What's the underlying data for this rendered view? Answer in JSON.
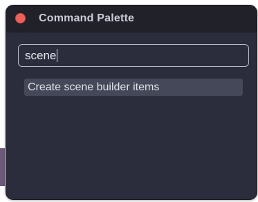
{
  "window": {
    "title": "Command Palette"
  },
  "search": {
    "value": "scene"
  },
  "results": [
    {
      "label": "Create scene builder items"
    }
  ]
}
